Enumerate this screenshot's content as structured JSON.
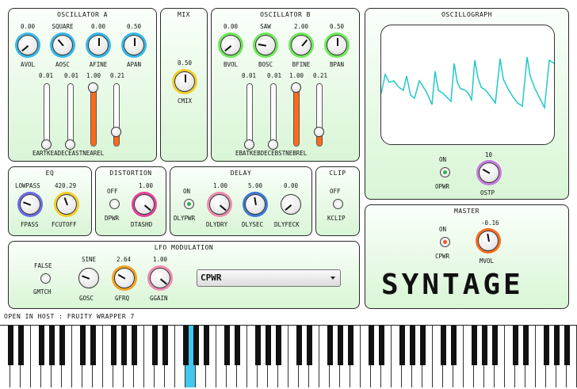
{
  "oscA": {
    "title": "OSCILLATOR A",
    "knobs": [
      {
        "value": "0.00",
        "label": "AVOL",
        "ring": "#36b8e8"
      },
      {
        "value": "SQUARE",
        "label": "AOSC",
        "ring": "#36b8e8"
      },
      {
        "value": "0.00",
        "label": "AFINE",
        "ring": "#36b8e8"
      },
      {
        "value": "0.50",
        "label": "APAN",
        "ring": "#36b8e8"
      }
    ],
    "sliders": [
      "0.01",
      "0.01",
      "1.00",
      "0.21"
    ],
    "adsr_label": "EARTKEADECEASTNEAREL"
  },
  "mix": {
    "title": "MIX",
    "value": "0.50",
    "label": "CMIX"
  },
  "oscB": {
    "title": "OSCILLATOR B",
    "knobs": [
      {
        "value": "0.00",
        "label": "BVOL",
        "ring": "#6ee85a"
      },
      {
        "value": "SAW",
        "label": "BOSC",
        "ring": "#6ee85a"
      },
      {
        "value": "2.00",
        "label": "BFINE",
        "ring": "#6ee85a"
      },
      {
        "value": "0.50",
        "label": "BPAN",
        "ring": "#6ee85a"
      }
    ],
    "sliders": [
      "0.01",
      "0.01",
      "1.00",
      "0.21"
    ],
    "adsr_label": "EBATKEBDECEBSTNEBREL"
  },
  "oscillograph": {
    "title": "OSCILLOGRAPH",
    "opwr_state": "ON",
    "opwr_label": "OPWR",
    "ostp_value": "10",
    "ostp_label": "OSTP"
  },
  "eq": {
    "title": "EQ",
    "fpass_value": "LOWPASS",
    "fpass_label": "FPASS",
    "fcutoff_value": "420.29",
    "fcutoff_label": "FCUTOFF"
  },
  "distortion": {
    "title": "DISTORTION",
    "dpwr_state": "OFF",
    "dpwr_label": "DPWR",
    "dtashd_value": "1.00",
    "dtashd_label": "DTASHD"
  },
  "delay": {
    "title": "DELAY",
    "dlypwr_state": "ON",
    "dlypwr_label": "DLYPWR",
    "knobs": [
      {
        "value": "1.00",
        "label": "DLYDRY"
      },
      {
        "value": "5.00",
        "label": "DLYSEC"
      },
      {
        "value": "0.00",
        "label": "DLYFECK"
      }
    ]
  },
  "clip": {
    "title": "CLIP",
    "state": "OFF",
    "label": "KCLIP"
  },
  "master": {
    "title": "MASTER",
    "cpwr_state": "ON",
    "cpwr_label": "CPWR",
    "mvol_value": "-0.16",
    "mvol_label": "MVOL"
  },
  "lfo": {
    "title": "LFO MODULATION",
    "gmtch_state": "FALSE",
    "gmtch_label": "GMTCH",
    "gosc_value": "SINE",
    "gosc_label": "GOSC",
    "gfrq_value": "2.64",
    "gfrq_label": "GFRQ",
    "ggain_value": "1.00",
    "ggain_label": "GGAIN",
    "dropdown_value": "CPWR"
  },
  "logo": "SYNTAGE",
  "status_bar": "OPEN IN HOST : FRUITY WRAPPER 7",
  "keyboard": {
    "pressed_key_index": 18
  },
  "colors": {
    "orange": "#ff6a1a",
    "cyan": "#36b8e8",
    "green": "#6ee85a",
    "pink": "#e8409a",
    "wave": "#22c8c8"
  }
}
